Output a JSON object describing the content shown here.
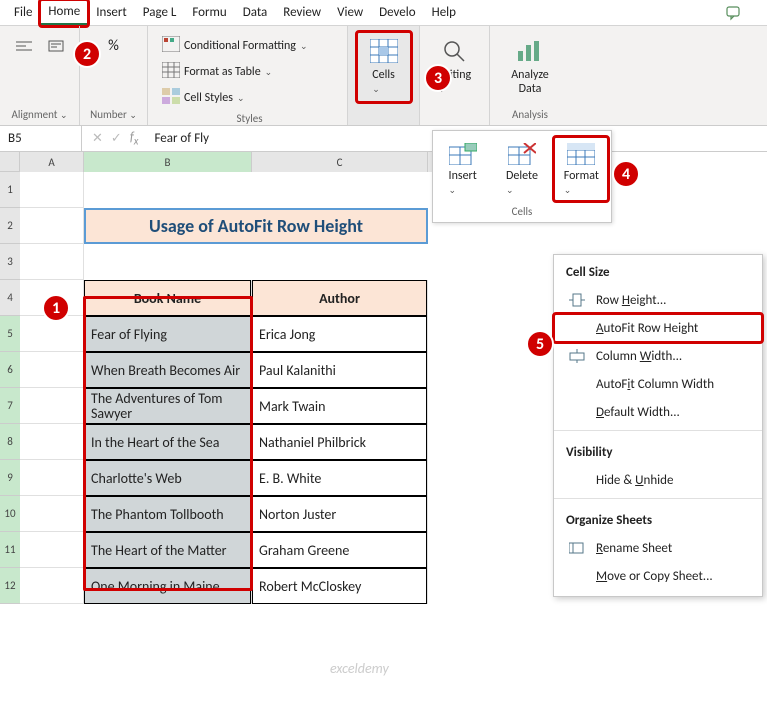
{
  "tabs": [
    "File",
    "Home",
    "Insert",
    "Page L",
    "Formu",
    "Data",
    "Review",
    "View",
    "Develo",
    "Help"
  ],
  "ribbon": {
    "alignment": {
      "label": "Alignment"
    },
    "number": {
      "percent": "%",
      "label": "Number"
    },
    "styles": {
      "cond_fmt": "Conditional Formatting",
      "table": "Format as Table",
      "cell_styles": "Cell Styles",
      "label": "Styles"
    },
    "cells": {
      "label": "Cells"
    },
    "editing": {
      "label": "Editing"
    },
    "analysis": {
      "analyze1": "Analyze",
      "analyze2": "Data",
      "label": "Analysis"
    }
  },
  "namebox": "B5",
  "formula": "Fear of Fly",
  "title": "Usage of AutoFit Row Height",
  "thead": {
    "book": "Book Name",
    "author": "Author"
  },
  "rows": [
    {
      "book": "Fear of Flying",
      "author": "Erica Jong"
    },
    {
      "book": "When Breath Becomes Air",
      "author": "Paul Kalanithi"
    },
    {
      "book": "The Adventures of Tom Sawyer",
      "author": "Mark Twain"
    },
    {
      "book": "In the Heart of the Sea",
      "author": "Nathaniel Philbrick"
    },
    {
      "book": "Charlotte's Web",
      "author": "E. B. White"
    },
    {
      "book": "The Phantom Tollbooth",
      "author": "Norton Juster"
    },
    {
      "book": "The Heart of the Matter",
      "author": "Graham Greene"
    },
    {
      "book": "One Morning in Maine",
      "author": "Robert McCloskey"
    }
  ],
  "pop1": {
    "insert": "Insert",
    "delete": "Delete",
    "format": "Format",
    "label": "Cells"
  },
  "pop2": {
    "cellsize": "Cell Size",
    "rowheight": "Row Height...",
    "autofit_row": "AutoFit Row Height",
    "colwidth": "Column Width...",
    "autofit_col": "AutoFit Column Width",
    "defwidth": "Default Width...",
    "visibility": "Visibility",
    "hide": "Hide & Unhide",
    "organize": "Organize Sheets",
    "rename": "Rename Sheet",
    "move": "Move or Copy Sheet..."
  },
  "nums": {
    "n1": "1",
    "n2": "2",
    "n3": "3",
    "n4": "4",
    "n5": "5"
  },
  "chev": "⌄",
  "watermark": "exceldemy"
}
